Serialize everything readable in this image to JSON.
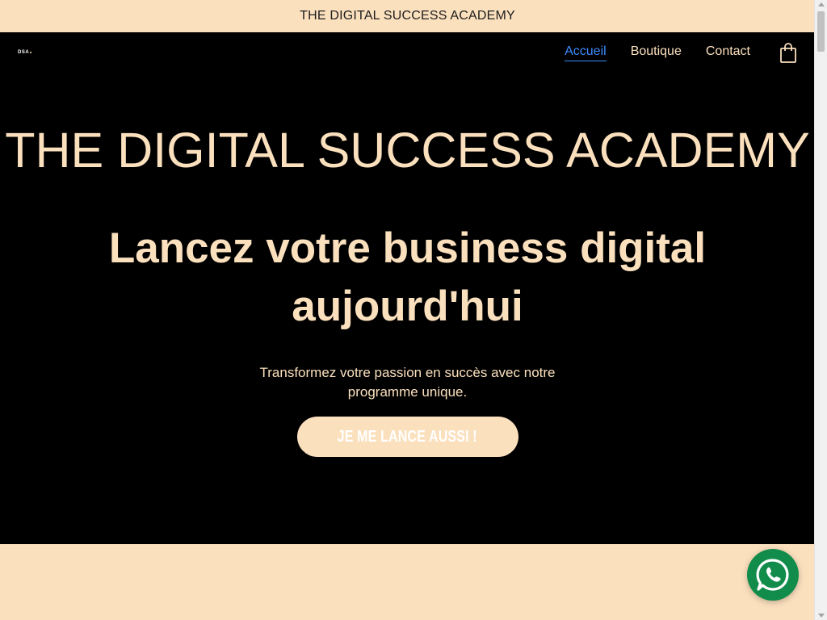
{
  "announcement": "THE DIGITAL SUCCESS ACADEMY",
  "logo": "DSA",
  "nav": {
    "items": [
      {
        "label": "Accueil",
        "active": true
      },
      {
        "label": "Boutique",
        "active": false
      },
      {
        "label": "Contact",
        "active": false
      }
    ],
    "cart_icon": "shopping-bag-icon"
  },
  "hero": {
    "title": "THE DIGITAL SUCCESS ACADEMY",
    "subtitle": "Lancez votre business digital aujourd'hui",
    "description": "Transformez votre passion en succès avec notre programme unique.",
    "cta_label": "JE ME LANCE AUSSI !"
  },
  "floating": {
    "whatsapp_icon": "whatsapp-icon"
  },
  "colors": {
    "accent": "#fbe0be",
    "background": "#000000",
    "active_link": "#3e8bff",
    "whatsapp": "#128c4b"
  }
}
